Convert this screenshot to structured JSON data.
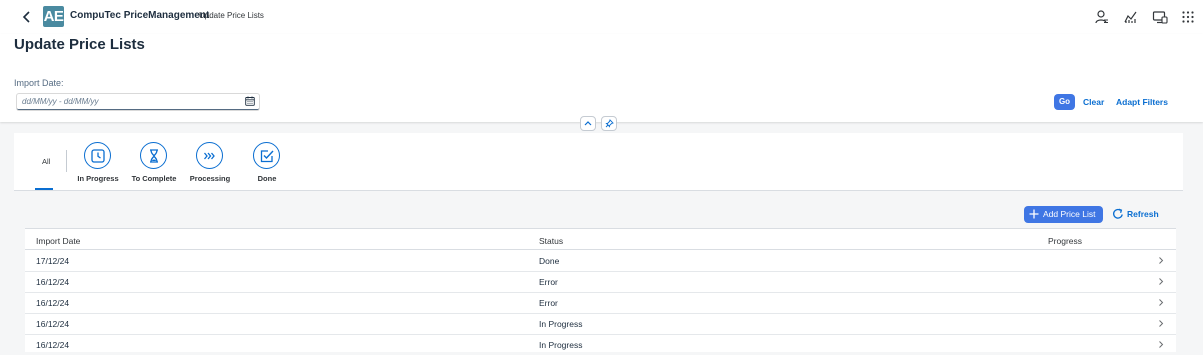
{
  "shell": {
    "logo_text": "AE",
    "app_title": "CompuTec PriceManagement",
    "subtitle": "Update Price Lists",
    "icons": [
      "user-settings-icon",
      "analytics-icon",
      "monitor-icon",
      "grid-menu-icon"
    ]
  },
  "page": {
    "title": "Update Price Lists"
  },
  "filter": {
    "import_label": "Import Date:",
    "date_placeholder": "dd/MM/yy - dd/MM/yy",
    "go_label": "Go",
    "clear_label": "Clear",
    "adapt_label": "Adapt Filters"
  },
  "tabs": {
    "all_label": "All",
    "items": [
      {
        "label": "In Progress",
        "icon": "clock-icon"
      },
      {
        "label": "To Complete",
        "icon": "hourglass-icon"
      },
      {
        "label": "Processing",
        "icon": "forward-icon"
      },
      {
        "label": "Done",
        "icon": "checkbox-icon"
      }
    ]
  },
  "toolbar": {
    "add_label": "Add Price List",
    "refresh_label": "Refresh"
  },
  "table": {
    "columns": [
      "Import Date",
      "Status",
      "Progress"
    ],
    "rows": [
      {
        "date": "17/12/24",
        "status": "Done"
      },
      {
        "date": "16/12/24",
        "status": "Error"
      },
      {
        "date": "16/12/24",
        "status": "Error"
      },
      {
        "date": "16/12/24",
        "status": "In Progress"
      },
      {
        "date": "16/12/24",
        "status": "In Progress"
      }
    ]
  },
  "colors": {
    "accent": "#0a6ed1",
    "button": "#3f76e4",
    "logo_bg": "#4a8aa0"
  }
}
